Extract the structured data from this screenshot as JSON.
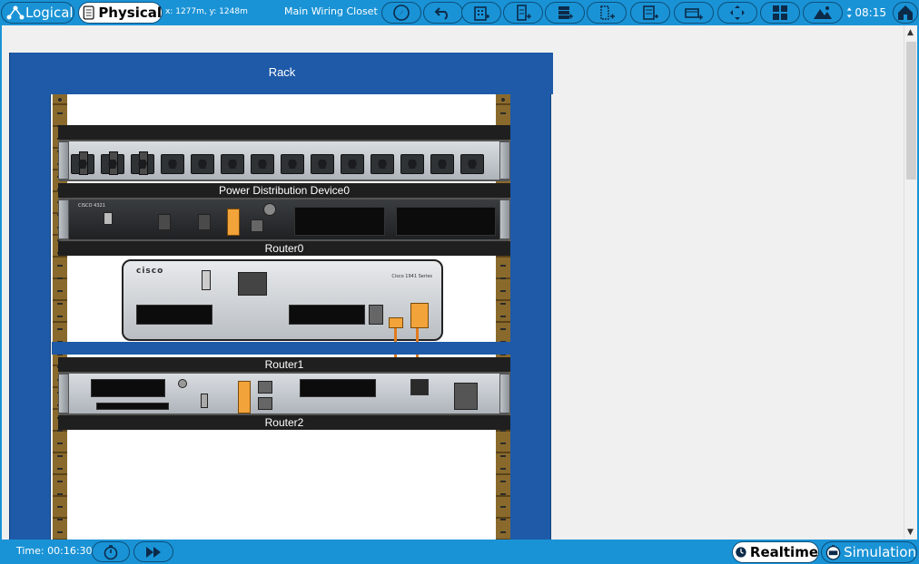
{
  "toolbar": {
    "logical_label": "Logical",
    "physical_label": "Physical",
    "coordinates": "x: 1277m, y: 1248m",
    "location": "Main Wiring Closet",
    "clock": "08:15",
    "buttons": [
      "navigation-icon",
      "undo-icon",
      "new-building-icon",
      "new-closet-icon",
      "new-rack-icon",
      "new-table-icon",
      "move-object-icon",
      "new-cluster-icon",
      "pan-icon",
      "tile-icon",
      "background-image-icon"
    ]
  },
  "workspace": {
    "rack_title": "Rack",
    "devices": [
      {
        "label": "Power Distribution Device0"
      },
      {
        "label": "Router0"
      },
      {
        "label": "Router1"
      },
      {
        "label": "Router2"
      }
    ],
    "router0_brand": "CISCO 4321",
    "router1_brand": "cisco",
    "router1_series": "Cisco 1941 Series"
  },
  "bottom": {
    "time": "Time: 00:16:30",
    "realtime_label": "Realtime",
    "simulation_label": "Simulation"
  },
  "colors": {
    "accent": "#1a93d6",
    "rack": "#1e5aa8",
    "cable": "#e07b1e",
    "port": "#f2a33a"
  }
}
